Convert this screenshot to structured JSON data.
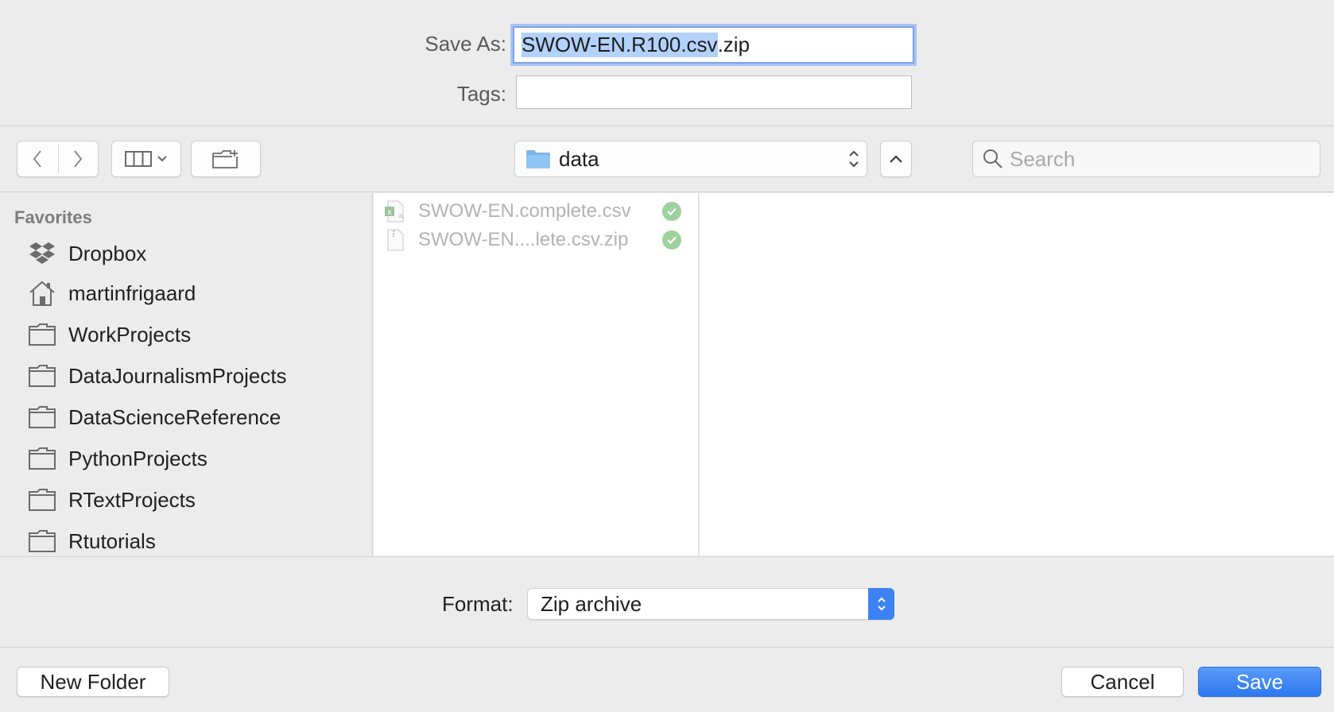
{
  "save_as": {
    "label": "Save As:",
    "value_selected": "SWOW-EN.R100.csv",
    "value_rest": ".zip"
  },
  "tags": {
    "label": "Tags:",
    "value": ""
  },
  "toolbar": {
    "location": "data",
    "search_placeholder": "Search"
  },
  "sidebar": {
    "heading": "Favorites",
    "items": [
      {
        "label": "Dropbox",
        "icon": "dropbox-icon"
      },
      {
        "label": "martinfrigaard",
        "icon": "home-icon"
      },
      {
        "label": "WorkProjects",
        "icon": "folder-icon"
      },
      {
        "label": "DataJournalismProjects",
        "icon": "folder-icon"
      },
      {
        "label": "DataScienceReference",
        "icon": "folder-icon"
      },
      {
        "label": "PythonProjects",
        "icon": "folder-icon"
      },
      {
        "label": "RTextProjects",
        "icon": "folder-icon"
      },
      {
        "label": "Rtutorials",
        "icon": "folder-icon"
      }
    ]
  },
  "files": [
    {
      "name": "SWOW-EN.complete.csv",
      "icon": "spreadsheet-file-icon",
      "synced": true
    },
    {
      "name": "SWOW-EN....lete.csv.zip",
      "icon": "zip-file-icon",
      "synced": true
    }
  ],
  "format": {
    "label": "Format:",
    "value": "Zip archive"
  },
  "buttons": {
    "new_folder": "New Folder",
    "cancel": "Cancel",
    "save": "Save"
  },
  "colors": {
    "accent": "#3d82f2",
    "selection": "#b3d2fb",
    "synced": "#9ed19e",
    "folder_blue": "#7ab6ea"
  }
}
